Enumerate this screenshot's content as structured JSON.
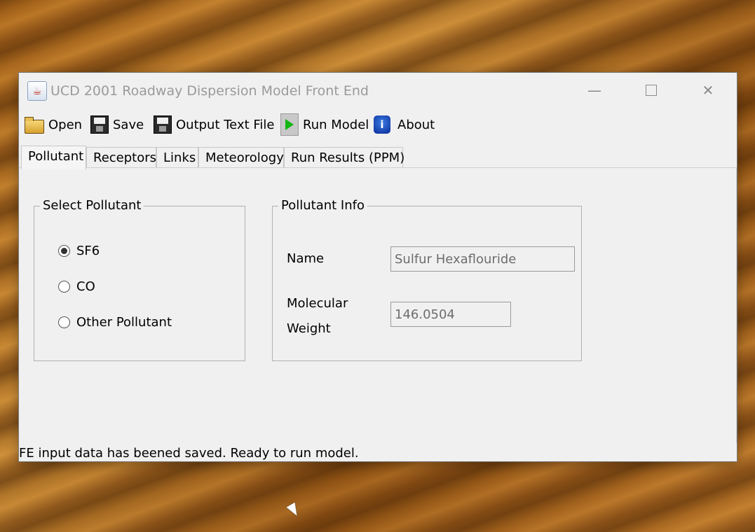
{
  "window": {
    "title": "UCD 2001 Roadway Dispersion Model Front End",
    "controls": {
      "minimize": "—",
      "maximize": "",
      "close": "✕"
    }
  },
  "toolbar": {
    "open_label": "Open",
    "save_label": "Save",
    "output_label": "Output Text File",
    "run_label": "Run Model",
    "about_label": "About"
  },
  "tabs": [
    {
      "label": "Pollutant",
      "active": true
    },
    {
      "label": "Receptors"
    },
    {
      "label": "Links"
    },
    {
      "label": "Meteorology"
    },
    {
      "label": "Run Results (PPM)"
    }
  ],
  "select_pollutant": {
    "title": "Select Pollutant",
    "options": [
      {
        "label": "SF6",
        "checked": true
      },
      {
        "label": "CO",
        "checked": false
      },
      {
        "label": "Other Pollutant",
        "checked": false
      }
    ]
  },
  "pollutant_info": {
    "title": "Pollutant Info",
    "name_label": "Name",
    "name_value": "Sulfur Hexaflouride",
    "mw_label_line1": "Molecular",
    "mw_label_line2": "Weight",
    "mw_value": "146.0504"
  },
  "status_text": "FE input data has beened saved. Ready to run model.",
  "icons": {
    "app": "java-icon",
    "open": "folder-open-icon",
    "save": "floppy-disk-icon",
    "output": "floppy-disk-icon",
    "run": "play-icon",
    "about": "about-icon"
  }
}
